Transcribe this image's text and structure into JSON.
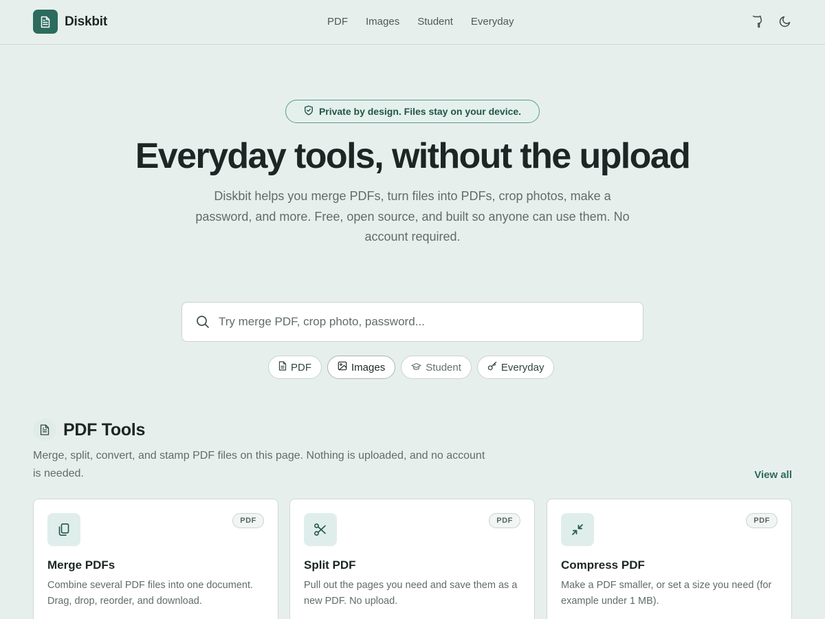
{
  "brand": {
    "name": "Diskbit",
    "accent": "#2c6b5d"
  },
  "nav": [
    {
      "label": "PDF"
    },
    {
      "label": "Images"
    },
    {
      "label": "Student"
    },
    {
      "label": "Everyday"
    }
  ],
  "header_icons": [
    "github-icon",
    "moon-icon"
  ],
  "hero": {
    "badge": "Private by design. Files stay on your device.",
    "title": "Everyday tools, without the upload",
    "subtitle": "Diskbit helps you merge PDFs, turn files into PDFs, crop photos, make a password, and more. Free, open source, and built so anyone can use them. No account required."
  },
  "search": {
    "placeholder": "Try merge PDF, crop photo, password..."
  },
  "chips": [
    {
      "label": "PDF",
      "icon": "document-icon"
    },
    {
      "label": "Images",
      "icon": "image-icon"
    },
    {
      "label": "Student",
      "icon": "graduation-cap-icon"
    },
    {
      "label": "Everyday",
      "icon": "key-icon"
    }
  ],
  "section": {
    "title": "PDF Tools",
    "description": "Merge, split, convert, and stamp PDF files on this page. Nothing is uploaded, and no account is needed.",
    "view_all": "View all"
  },
  "cards": [
    {
      "title": "Merge PDFs",
      "badge": "PDF",
      "icon": "merge-icon",
      "description": "Combine several PDF files into one document. Drag, drop, reorder, and download."
    },
    {
      "title": "Split PDF",
      "badge": "PDF",
      "icon": "scissors-icon",
      "description": "Pull out the pages you need and save them as a new PDF. No upload."
    },
    {
      "title": "Compress PDF",
      "badge": "PDF",
      "icon": "compress-icon",
      "description": "Make a PDF smaller, or set a size you need (for example under 1 MB)."
    }
  ]
}
